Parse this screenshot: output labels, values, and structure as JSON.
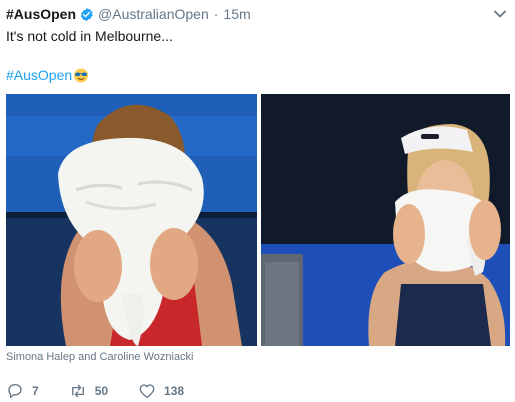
{
  "tweet": {
    "display_name": "#AusOpen",
    "handle": "@AustralianOpen",
    "separator": "·",
    "time": "15m",
    "text": "It's not cold in Melbourne...",
    "hashtag": "#AusOpen",
    "media_caption": "Simona Halep and Caroline Wozniacki",
    "counts": {
      "replies": "7",
      "retweets": "50",
      "likes": "138"
    }
  },
  "icons": {
    "verified": "verified-badge-icon",
    "menu": "chevron-down-icon",
    "emoji": "sunglasses-emoji-icon",
    "reply": "reply-icon",
    "retweet": "retweet-icon",
    "like": "heart-icon"
  },
  "colors": {
    "link": "#1da1f2",
    "muted": "#657786",
    "text": "#14171a",
    "court_blue": "#1e4fb8"
  }
}
